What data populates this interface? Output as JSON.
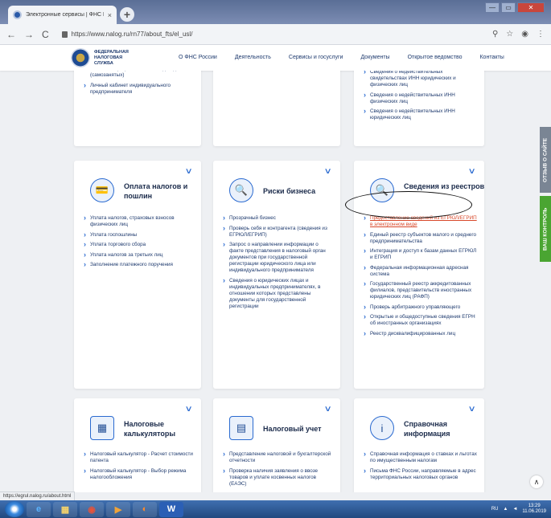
{
  "browser": {
    "tab_title": "Электронные сервисы | ФНС Р...",
    "tab_close": "×",
    "new_tab": "+",
    "url": "https://www.nalog.ru/rn77/about_fts/el_usl/",
    "back": "←",
    "forward": "→",
    "reload": "C",
    "minimize": "—",
    "maximize": "▭",
    "close": "✕",
    "zoom_icon": "⚲",
    "star_icon": "☆",
    "menu_icon": "⋮"
  },
  "header": {
    "logo_text": "ФЕДЕРАЛЬНАЯ НАЛОГОВАЯ СЛУЖБА",
    "nav": [
      "О ФНС России",
      "Деятельность",
      "Сервисы и госуслуги",
      "Документы",
      "Открытое ведомство",
      "Контакты"
    ]
  },
  "cards": {
    "top_left": {
      "items": [
        "налога на профессиональный доход (самозанятых)",
        "Личный кабинет индивидуального предпринимателя"
      ]
    },
    "top_right": {
      "items": [
        "Сведения о недействительных свидетельствах ИНН юридических и физических лиц",
        "Сведения о недействительных ИНН физических лиц",
        "Сведения о недействительных ИНН юридических лиц"
      ]
    },
    "pay": {
      "title": "Оплата налогов и пошлин",
      "items": [
        "Уплата налогов, страховых взносов физических лиц",
        "Уплата госпошлины",
        "Уплата торгового сбора",
        "Уплата налогов за третьих лиц",
        "Заполнение платежного поручения"
      ]
    },
    "risk": {
      "title": "Риски бизнеса",
      "items": [
        "Прозрачный бизнес",
        "Проверь себя и контрагента (сведения из ЕГРЮЛ/ЕГРИП)",
        "Запрос о направлении информации о факте представления в налоговый орган документов при государственной регистрации юридического лица или индивидуального предпринимателя",
        "Сведения о юридических лицах и индивидуальных предпринимателях, в отношении которых представлены документы для государственной регистрации"
      ]
    },
    "registry": {
      "title": "Сведения из реестров",
      "items": [
        "Предоставление сведений из ЕГРЮЛ/ЕГРИП в электронном виде",
        "Единый реестр субъектов малого и среднего предпринимательства",
        "Интеграция и доступ к базам данных ЕГРЮЛ и ЕГРИП",
        "Федеральная информационная адресная система",
        "Государственный реестр аккредитованных филиалов, представительств иностранных юридических лиц (РАФП)",
        "Проверь арбитражного управляющего",
        "Открытые и общедоступные сведения ЕГРН об иностранных организациях",
        "Реестр дисквалифицированных лиц"
      ]
    },
    "calc": {
      "title": "Налоговые калькуляторы",
      "items": [
        "Налоговый калькулятор - Расчет стоимости патента",
        "Налоговый калькулятор - Выбор режима налогообложения"
      ]
    },
    "account": {
      "title": "Налоговый учет",
      "items": [
        "Представление налоговой и бухгалтерской отчетности",
        "Проверка наличия заявления о ввозе товаров и уплате косвенных налогов (ЕАЭС)"
      ]
    },
    "reference": {
      "title": "Справочная информация",
      "items": [
        "Справочная информация о ставках и льготах по имущественным налогам",
        "Письма ФНС России, направляемые в адрес территориальных налоговых органов"
      ]
    }
  },
  "icons": {
    "pay": "💳",
    "risk": "🔍",
    "registry": "🔍",
    "calc": "▦",
    "account": "▤",
    "reference": "i",
    "chevron": "∨"
  },
  "sidetabs": {
    "feedback": "ОТЗЫВ О САЙТЕ",
    "control": "ВАШ КОНТРОЛЬ"
  },
  "scroll_top": "∧",
  "status_url": "https://egrul.nalog.ru/about.html",
  "taskbar": {
    "apps": [
      "e",
      "▦",
      "◉",
      "▶",
      "◐",
      "W"
    ],
    "lang": "RU",
    "time": "13:29",
    "date": "11.06.2019"
  },
  "colors": {
    "accent": "#2a6ad0",
    "link": "#1e3a6e",
    "highlight": "#d8482a",
    "control_tab": "#4aa532"
  }
}
